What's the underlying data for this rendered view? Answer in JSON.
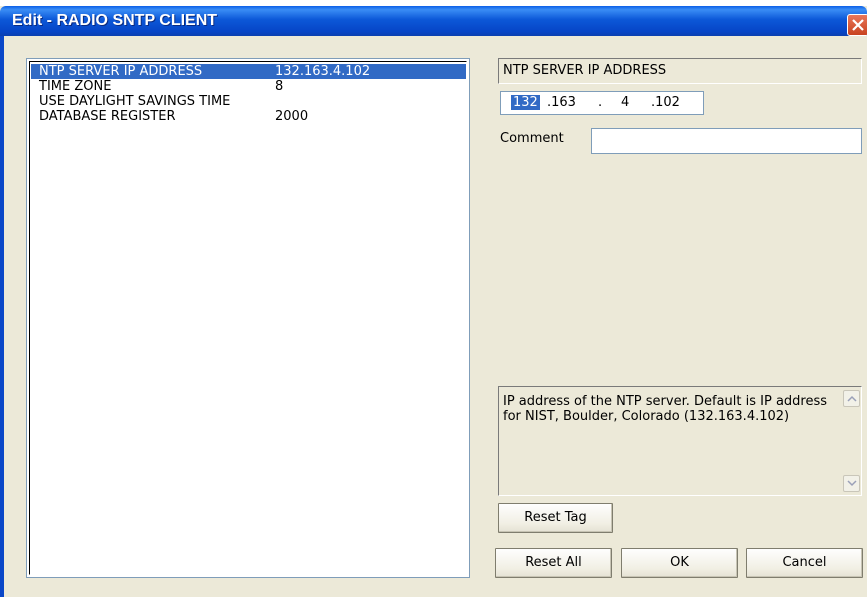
{
  "window": {
    "title": "Edit - RADIO SNTP CLIENT"
  },
  "params": [
    {
      "name": "NTP SERVER IP ADDRESS",
      "value": "132.163.4.102",
      "selected": true
    },
    {
      "name": "TIME ZONE",
      "value": "8"
    },
    {
      "name": "USE DAYLIGHT SAVINGS TIME",
      "value": ""
    },
    {
      "name": "DATABASE REGISTER",
      "value": "2000"
    }
  ],
  "editor": {
    "param_title": "NTP SERVER IP ADDRESS",
    "ip": [
      "132",
      ".163",
      ".",
      "4",
      ".102"
    ],
    "comment_label": "Comment",
    "comment_value": "",
    "help": "IP address of the NTP server. Default is IP address for NIST, Boulder, Colorado (132.163.4.102)"
  },
  "buttons": {
    "reset_tag": "Reset Tag",
    "reset_all": "Reset All",
    "ok": "OK",
    "cancel": "Cancel"
  }
}
